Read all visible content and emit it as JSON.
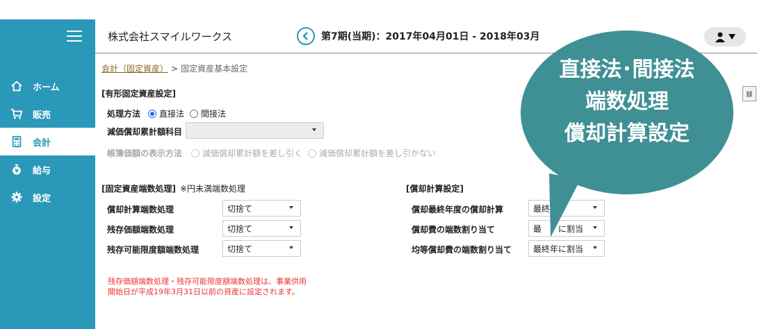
{
  "sidebar": {
    "items": [
      {
        "label": "ホーム",
        "icon": "home-icon",
        "active": false
      },
      {
        "label": "販売",
        "icon": "cart-icon",
        "active": false
      },
      {
        "label": "会計",
        "icon": "calculator-icon",
        "active": true
      },
      {
        "label": "給与",
        "icon": "money-bag-icon",
        "active": false
      },
      {
        "label": "設定",
        "icon": "gear-icon",
        "active": false
      }
    ]
  },
  "header": {
    "company": "株式会社スマイルワークス",
    "period": "第7期(当期)：2017年04月01日 - 2018年03月"
  },
  "breadcrumb": {
    "parent": "会計（固定資産）",
    "separator": ">",
    "current": "固定資産基本設定"
  },
  "tangible": {
    "title": "[有形固定資産設定]",
    "method_label": "処理方法",
    "method_options": [
      "直接法",
      "間接法"
    ],
    "method_selected": "直接法",
    "account_label": "減価償却累計額科目",
    "account_value": "",
    "display_label": "帳簿価額の表示方法",
    "display_options": [
      "減価償却累計額を差し引く",
      "減価償却累計額を差し引かない"
    ]
  },
  "rounding": {
    "title": "[固定資産端数処理]",
    "note": "※円未満端数処理",
    "rows": [
      {
        "label": "償却計算端数処理",
        "value": "切捨て"
      },
      {
        "label": "残存価額端数処理",
        "value": "切捨て"
      },
      {
        "label": "残存可能限度額端数処理",
        "value": "切捨て"
      }
    ]
  },
  "depreciation": {
    "title": "[償却計算設定]",
    "rows": [
      {
        "label": "償却最終年度の償却計算",
        "value": "最終"
      },
      {
        "label": "償却費の端数割り当て",
        "value": "最　　に割当"
      },
      {
        "label": "均等償却費の端数割り当て",
        "value": "最終年に割当"
      }
    ]
  },
  "warning": "残存価額端数処理・残存可能限度額端数処理は、事業供用開始日が平成19年3月31日以前の資産に設定されます。",
  "side_button": "録",
  "bubble": {
    "line1": "直接法･間接法",
    "line2": "端数処理",
    "line3": "償却計算設定"
  },
  "colors": {
    "sidebar": "#2a98b8",
    "bubble": "#3f9094",
    "warning": "#ee3333",
    "radio": "#1d6fe0"
  }
}
